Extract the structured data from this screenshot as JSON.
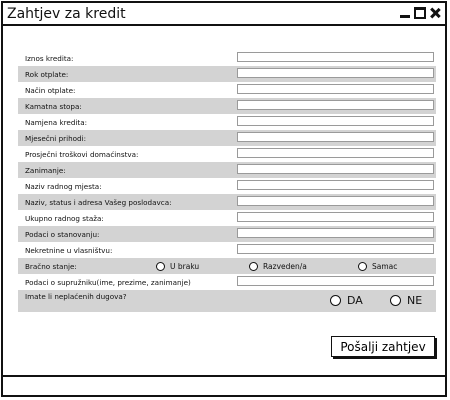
{
  "window": {
    "title": "Zahtjev za kredit"
  },
  "form": {
    "fields": [
      {
        "label": "Iznos kredita:",
        "value": ""
      },
      {
        "label": "Rok otplate:",
        "value": ""
      },
      {
        "label": "Način otplate:",
        "value": ""
      },
      {
        "label": "Kamatna stopa:",
        "value": ""
      },
      {
        "label": "Namjena kredita:",
        "value": ""
      },
      {
        "label": "Mjesečni prihodi:",
        "value": ""
      },
      {
        "label": "Prosječni troškovi domaćinstva:",
        "value": ""
      },
      {
        "label": "Zanimanje:",
        "value": ""
      },
      {
        "label": "Naziv radnog mjesta:",
        "value": ""
      },
      {
        "label": "Naziv, status i adresa Vašeg poslodavca:",
        "value": ""
      },
      {
        "label": "Ukupno radnog staža:",
        "value": ""
      },
      {
        "label": "Podaci o stanovanju:",
        "value": ""
      },
      {
        "label": "Nekretnine u vlasništvu:",
        "value": ""
      }
    ],
    "marital_status": {
      "label": "Bračno stanje:",
      "options": [
        "U braku",
        "Razveden/a",
        "Samac"
      ]
    },
    "spouse": {
      "label": "Podaci o supružniku(ime, prezime, zanimanje)",
      "value": ""
    },
    "debts": {
      "label": "Imate li neplaćenih dugova?",
      "options": [
        "DA",
        "NE"
      ]
    }
  },
  "actions": {
    "submit_label": "Pošalji zahtjev"
  }
}
